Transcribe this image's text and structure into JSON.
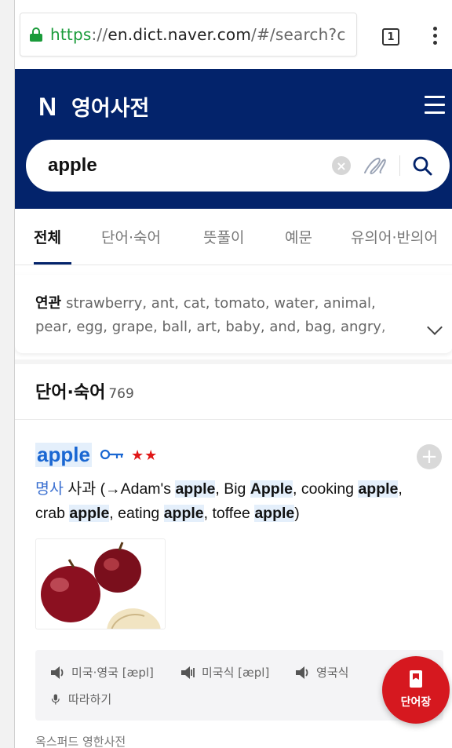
{
  "browser": {
    "url_scheme": "https",
    "url_rest_before_host": "://",
    "url_host": "en.dict.naver.com",
    "url_path": "/#/search?c",
    "tab_count": "1"
  },
  "header": {
    "logo": "N",
    "title": "영어사전"
  },
  "search": {
    "query": "apple"
  },
  "tabs": [
    {
      "label": "전체"
    },
    {
      "label": "단어·숙어"
    },
    {
      "label": "뜻풀이"
    },
    {
      "label": "예문"
    },
    {
      "label": "유의어·반의어"
    }
  ],
  "related": {
    "label": "연관",
    "line1": "strawberry,  ant,  cat,  tomato,  water,  animal,",
    "line2": "pear,  egg,  grape,  ball,  art,  baby,  and,  bag,  angry,"
  },
  "section": {
    "title": "단어·숙어",
    "count": "769"
  },
  "entry": {
    "word": "apple",
    "stars": "★★",
    "pos": "명사",
    "meaning_ko": " 사과 (→Adam's ",
    "hl1": "apple",
    "t1": ", Big ",
    "hl2": "Apple",
    "t2": ", cooking ",
    "hl3": "apple",
    "t3": ",",
    "t4": "crab ",
    "hl4": "apple",
    "t5": ", eating ",
    "hl5": "apple",
    "t6": ", toffee ",
    "hl6": "apple",
    "t7": ")"
  },
  "audio": {
    "us_uk": "미국·영국 [æpl]",
    "us": "미국식 [æpl]",
    "uk": "영국식",
    "repeat": "따라하기"
  },
  "fab": {
    "label": "단어장"
  },
  "bottom": {
    "text": "옥스퍼드 영한사전"
  },
  "colors": {
    "header_bg": "#03236b",
    "accent_blue": "#1a67d2",
    "star_red": "#e01717",
    "fab_red": "#d6181f",
    "secure_green": "#1a9b3a"
  }
}
